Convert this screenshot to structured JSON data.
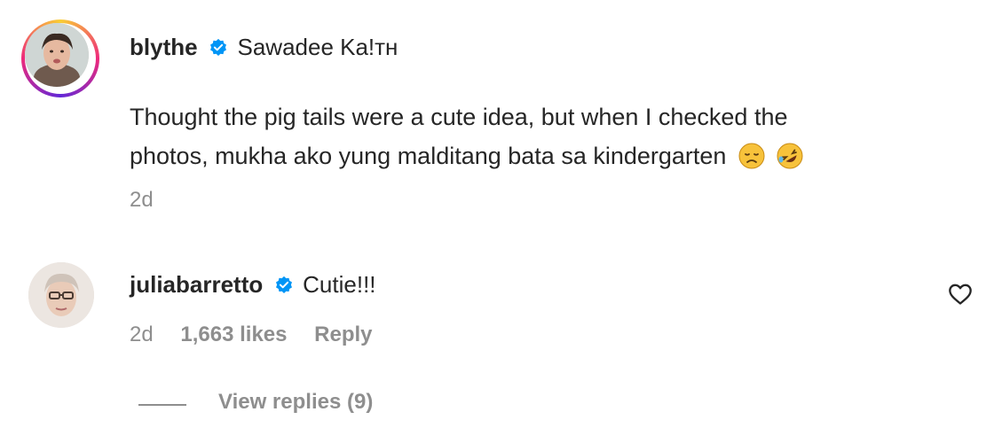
{
  "comments": [
    {
      "username": "blythe",
      "text": "Sawadee Ka!тн",
      "body_lines": [
        "Thought the pig tails were a cute idea, but when I checked the",
        "photos, mukha ako yung malditang bata sa kindergarten"
      ],
      "emojis": [
        "disappointed-face",
        "rolling-on-floor-laughing-face"
      ],
      "time": "2d"
    },
    {
      "username": "juliabarretto",
      "text": "Cutie!!!",
      "time": "2d",
      "likes": "1,663 likes",
      "reply_label": "Reply"
    }
  ],
  "view_replies": "View replies (9)",
  "colors": {
    "verified": "#0095f6",
    "meta_text": "#8e8e8e",
    "primary_text": "#262626"
  },
  "icons": [
    "verified-badge-icon",
    "heart-outline-icon"
  ]
}
